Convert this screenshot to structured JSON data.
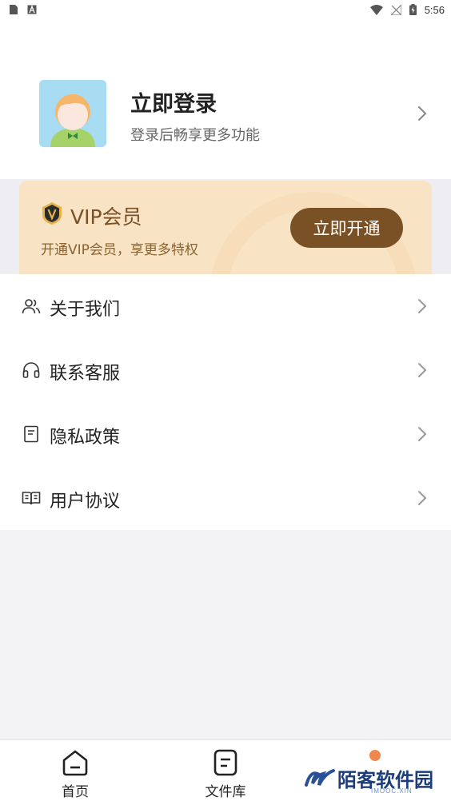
{
  "status_bar": {
    "time": "5:56",
    "left_icons": [
      "sim-card-icon",
      "keyboard-a-icon"
    ],
    "right_icons": [
      "wifi-icon",
      "no-signal-icon",
      "battery-charging-icon"
    ]
  },
  "profile": {
    "title": "立即登录",
    "subtitle": "登录后畅享更多功能",
    "avatar_icon": "default-avatar-icon",
    "chevron_icon": "chevron-right-icon"
  },
  "vip": {
    "badge_icon": "vip-shield-icon",
    "title": "VIP会员",
    "subtitle": "开通VIP会员，享更多特权",
    "button_label": "立即开通",
    "colors": {
      "card_bg": "#f8e3c5",
      "text": "#7a5124",
      "button_bg": "#7a5124"
    }
  },
  "menu": {
    "items": [
      {
        "label": "关于我们",
        "icon": "users-icon"
      },
      {
        "label": "联系客服",
        "icon": "headset-icon"
      },
      {
        "label": "隐私政策",
        "icon": "document-icon"
      },
      {
        "label": "用户协议",
        "icon": "open-book-icon"
      }
    ]
  },
  "bottom_nav": {
    "items": [
      {
        "label": "首页",
        "icon": "home-icon"
      },
      {
        "label": "文件库",
        "icon": "file-library-icon"
      }
    ]
  },
  "watermark": {
    "text": "陌客软件园",
    "subtext": "IMOOC.XIN"
  }
}
